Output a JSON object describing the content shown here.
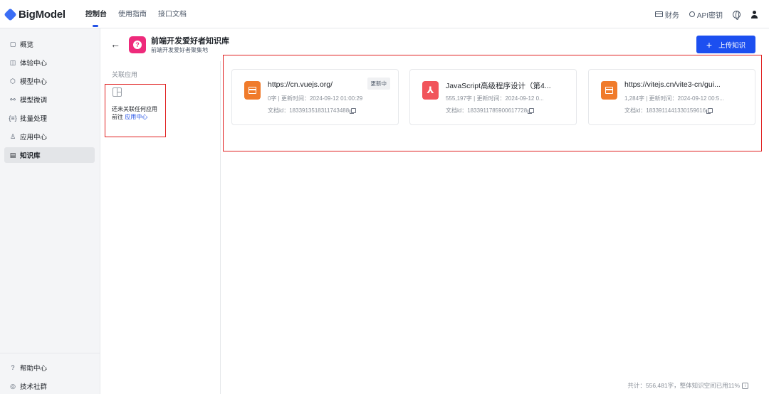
{
  "app": {
    "logo_text": "BigModel"
  },
  "nav": {
    "items": [
      {
        "label": "控制台",
        "active": true
      },
      {
        "label": "使用指南",
        "active": false
      },
      {
        "label": "接口文档",
        "active": false
      }
    ]
  },
  "top_right": {
    "finance": "财务",
    "api_key": "API密钥"
  },
  "sidebar": {
    "items": [
      {
        "label": "概览",
        "icon": "monitor-icon",
        "glyph": "▢"
      },
      {
        "label": "体验中心",
        "icon": "experience-icon",
        "glyph": "◫"
      },
      {
        "label": "模型中心",
        "icon": "cube-icon",
        "glyph": "⬡"
      },
      {
        "label": "模型微调",
        "icon": "tune-icon",
        "glyph": "⚯"
      },
      {
        "label": "批量处理",
        "icon": "batch-icon",
        "glyph": "{≡}"
      },
      {
        "label": "应用中心",
        "icon": "app-icon",
        "glyph": "♙"
      },
      {
        "label": "知识库",
        "icon": "knowledge-icon",
        "glyph": "▤",
        "active": true
      }
    ],
    "bottom": [
      {
        "label": "帮助中心",
        "icon": "help-icon",
        "glyph": "?"
      },
      {
        "label": "技术社群",
        "icon": "community-icon",
        "glyph": "◎"
      }
    ]
  },
  "kb": {
    "title": "前端开发爱好者知识库",
    "subtitle": "前端开发爱好者聚集地",
    "avatar_glyph": "?",
    "upload_label": "上传知识",
    "upload_plus": "+"
  },
  "assoc": {
    "label": "关联应用",
    "empty_line1": "还未关联任何应用",
    "goto_prefix": "前往 ",
    "goto_link": "应用中心"
  },
  "docs": [
    {
      "title": "https://cn.vuejs.org/",
      "meta": "0字 | 更新时间：2024-09-12 01:00:29",
      "doc_id": "文档id：1833913518311743488",
      "status": "更新中",
      "type": "web"
    },
    {
      "title": "JavaScript高级程序设计（第4...",
      "meta": "555,197字 | 更新时间：2024-09-12 0...",
      "doc_id": "文档id：1833911785900617728",
      "status": "",
      "type": "pdf"
    },
    {
      "title": "https://vitejs.cn/vite3-cn/gui...",
      "meta": "1,284字 | 更新时间：2024-09-12 00:5...",
      "doc_id": "文档id：1833911441330159616",
      "status": "",
      "type": "web"
    }
  ],
  "footer": {
    "stat": "共计：556,481字，整体知识空间已用11%"
  },
  "colors": {
    "accent": "#1c4ff0",
    "kb_avatar": "#ee2a7b",
    "web_icon": "#f07b2b",
    "pdf_icon": "#f1545b",
    "highlight_box": "#e02020"
  }
}
